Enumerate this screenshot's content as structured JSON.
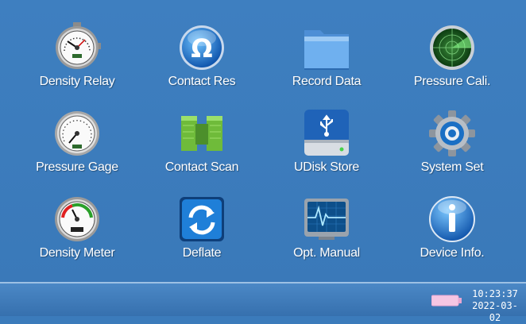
{
  "apps": [
    {
      "label": "Density Relay",
      "icon": "pressure-gauge-icon"
    },
    {
      "label": "Contact Res",
      "icon": "omega-icon"
    },
    {
      "label": "Record Data",
      "icon": "folder-icon"
    },
    {
      "label": "Pressure Cali.",
      "icon": "radar-icon"
    },
    {
      "label": "Pressure Gage",
      "icon": "pressure-gauge-icon"
    },
    {
      "label": "Contact Scan",
      "icon": "contact-scan-icon"
    },
    {
      "label": "UDisk Store",
      "icon": "usb-drive-icon"
    },
    {
      "label": "System Set",
      "icon": "gear-icon"
    },
    {
      "label": "Density Meter",
      "icon": "density-meter-icon"
    },
    {
      "label": "Deflate",
      "icon": "refresh-arrows-icon"
    },
    {
      "label": "Opt. Manual",
      "icon": "monitor-heartbeat-icon"
    },
    {
      "label": "Device Info.",
      "icon": "info-icon"
    }
  ],
  "status": {
    "time": "10:23:37",
    "date": "2022-03-02",
    "battery_icon": "battery-icon"
  },
  "colors": {
    "background": "#3b7bbb",
    "label": "#ffffff"
  }
}
